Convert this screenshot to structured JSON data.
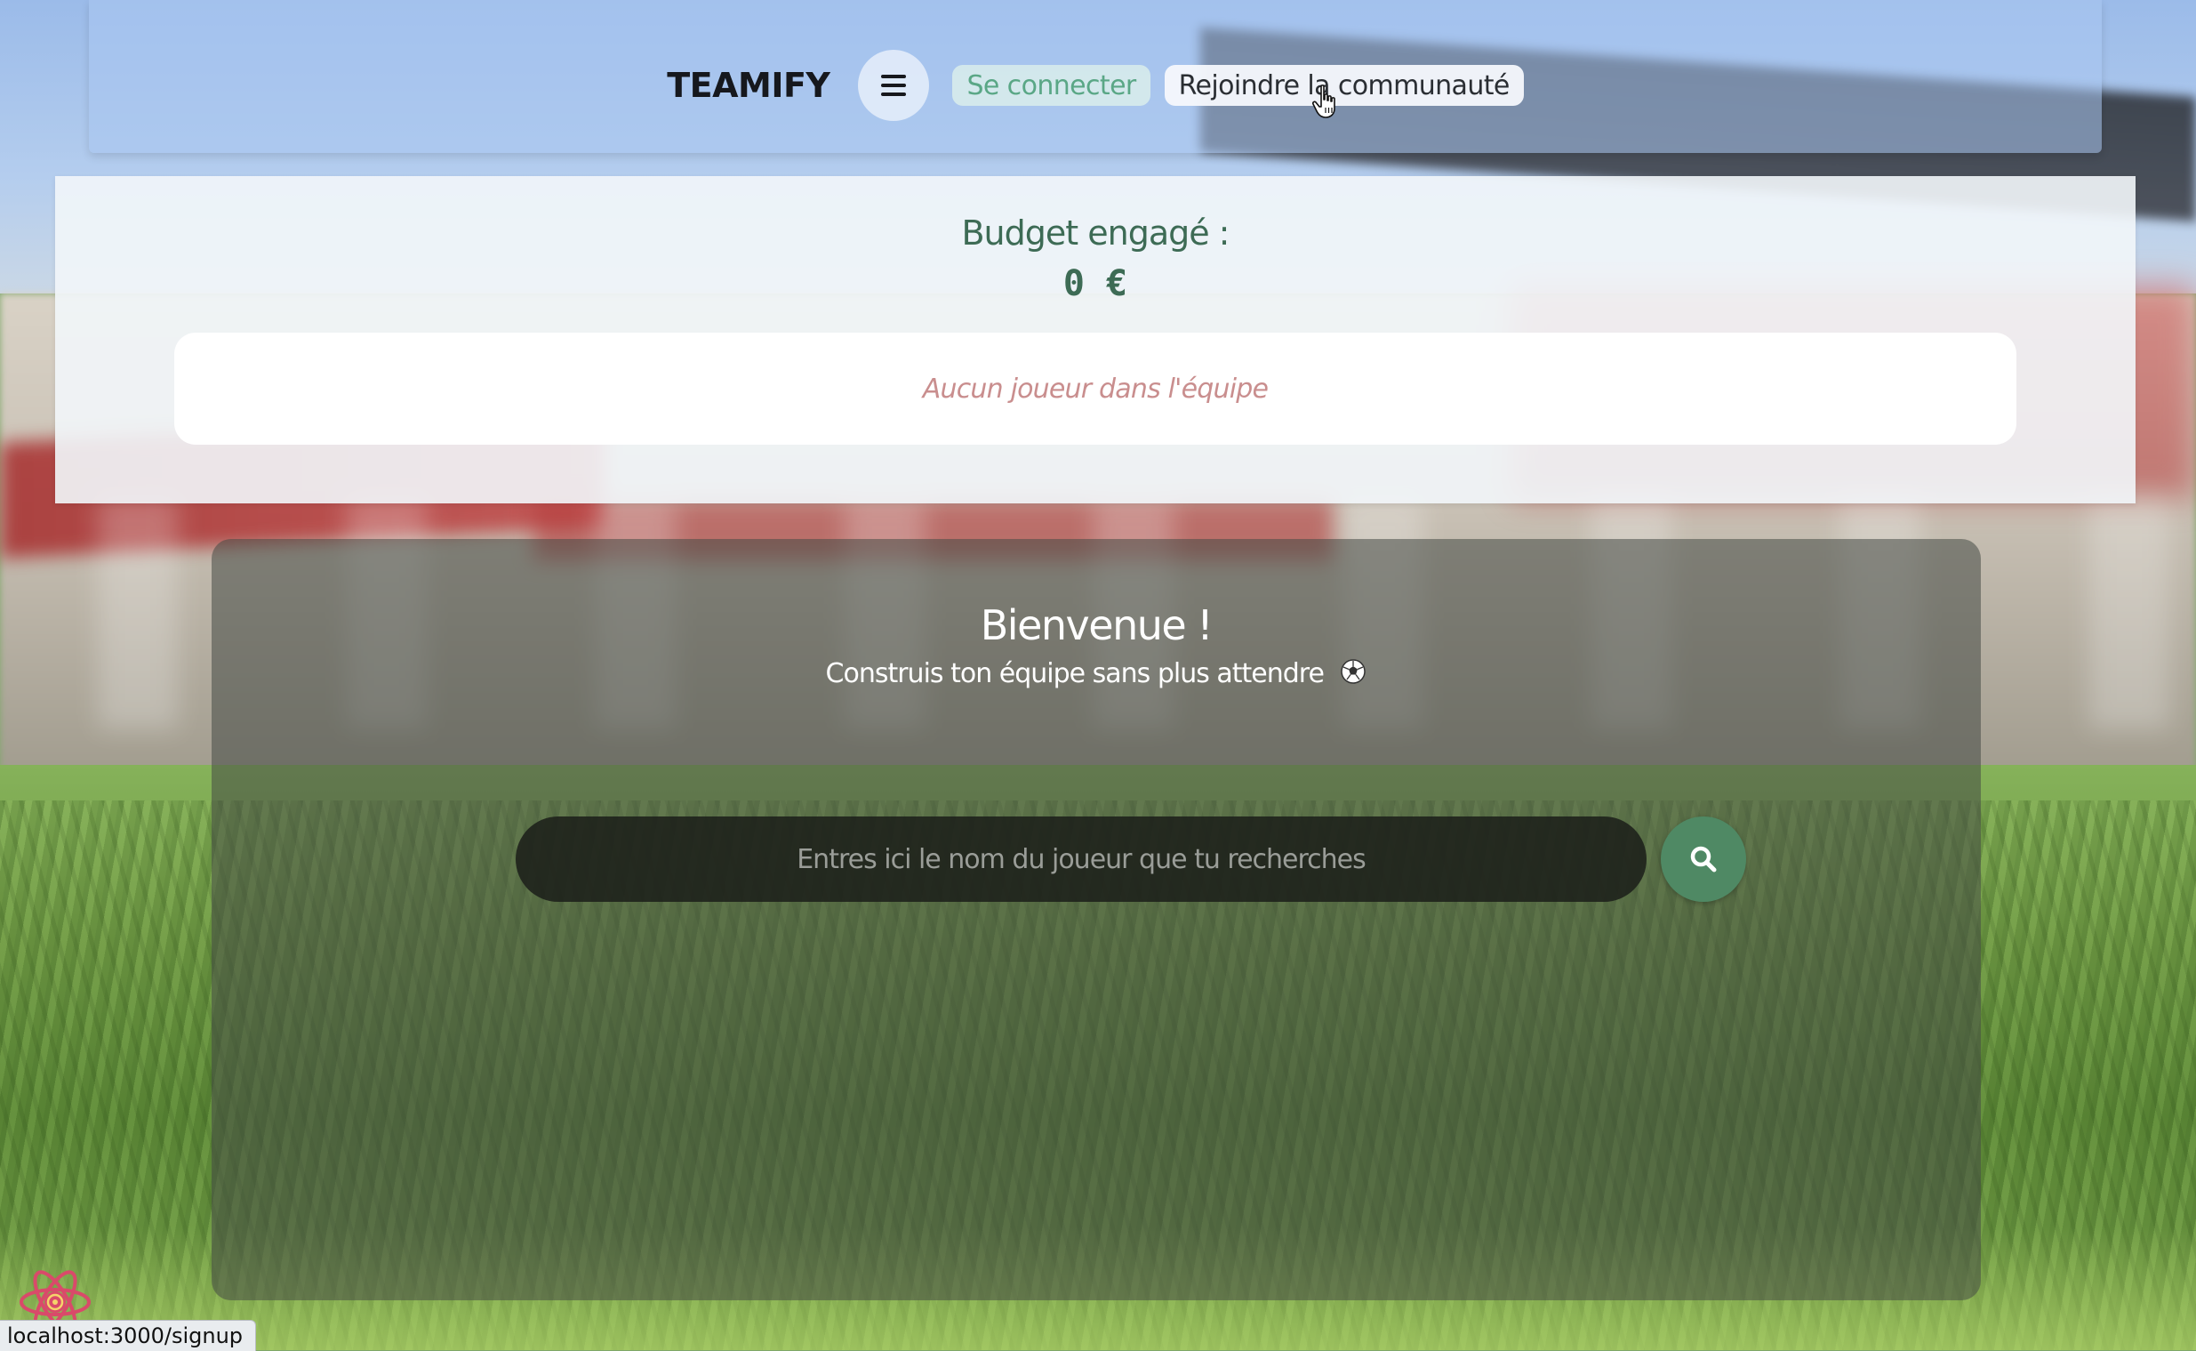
{
  "nav": {
    "brand": "TEAMIFY",
    "login_label": "Se connecter",
    "join_label": "Rejoindre la communauté"
  },
  "budget": {
    "label": "Budget engagé :",
    "value": "0 €"
  },
  "team": {
    "empty_text": "Aucun joueur dans l'équipe"
  },
  "welcome": {
    "title": "Bienvenue !",
    "subtitle": "Construis ton équipe sans plus attendre"
  },
  "search": {
    "placeholder": "Entres ici le nom du joueur que tu recherches",
    "value": ""
  },
  "status_bar": {
    "url": "localhost:3000/signup"
  },
  "icons": {
    "menu": "hamburger-menu-icon",
    "search": "magnifier-icon",
    "ball": "soccer-ball-icon",
    "cursor": "hand-pointer-icon",
    "devtools": "react-devtools-icon"
  },
  "colors": {
    "brand_text": "#16181d",
    "accent_green": "#4f8964",
    "budget_text": "#3d6b55",
    "login_text": "#5aa786",
    "empty_team_text": "#c98e8e",
    "react_logo": "#d94a6a"
  }
}
